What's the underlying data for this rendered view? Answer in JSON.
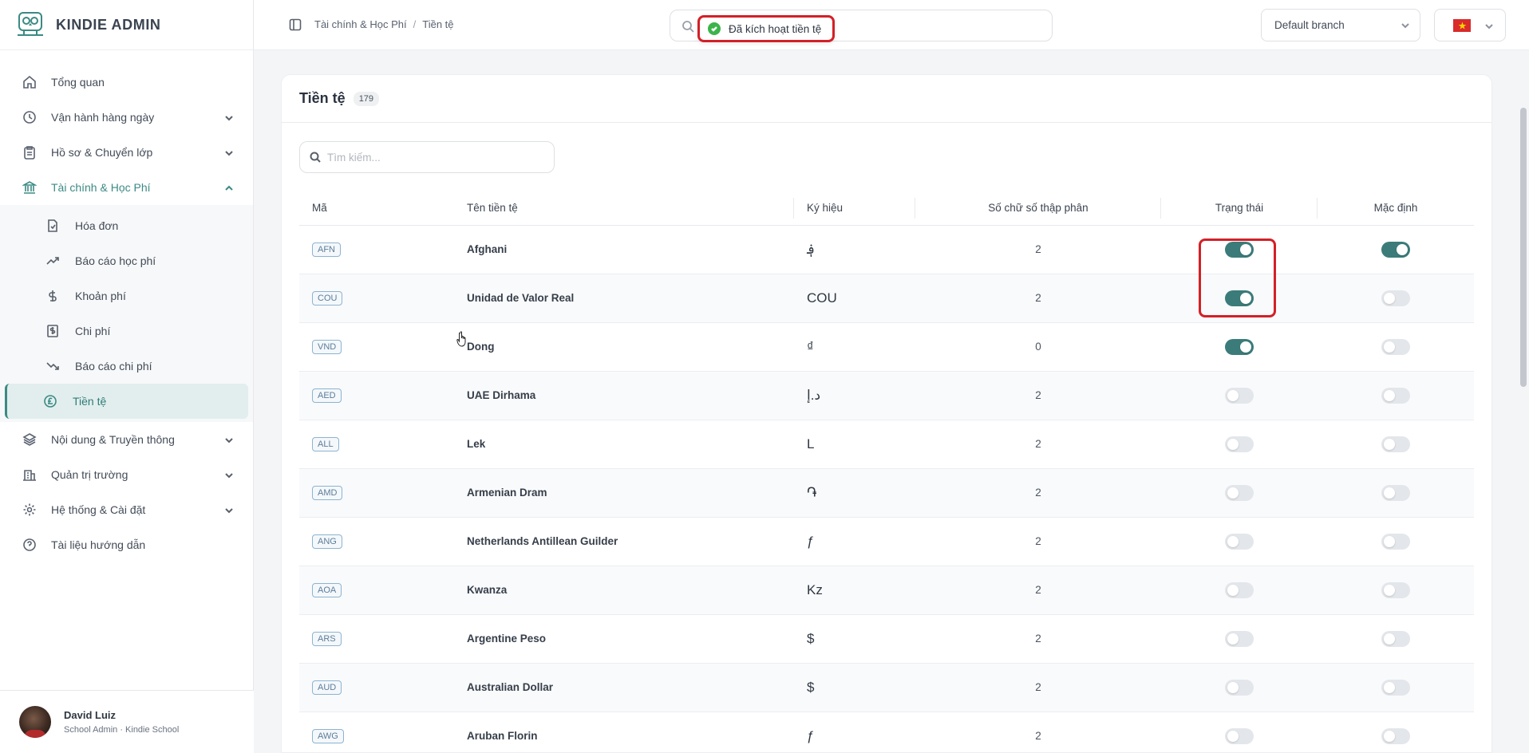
{
  "brand": {
    "name": "KINDIE ADMIN"
  },
  "sidebar": {
    "items": [
      {
        "label": "Tổng quan",
        "icon": "home-icon",
        "chevron": false
      },
      {
        "label": "Vận hành hàng ngày",
        "icon": "clock-icon",
        "chevron": true
      },
      {
        "label": "Hồ sơ & Chuyển lớp",
        "icon": "clipboard-icon",
        "chevron": true
      },
      {
        "label": "Tài chính & Học Phí",
        "icon": "bank-icon",
        "chevron": true,
        "expanded": true
      }
    ],
    "subitems": [
      {
        "label": "Hóa đơn",
        "icon": "invoice-icon"
      },
      {
        "label": "Báo cáo học phí",
        "icon": "trend-up-icon"
      },
      {
        "label": "Khoản phí",
        "icon": "dollar-icon"
      },
      {
        "label": "Chi phí",
        "icon": "receipt-icon"
      },
      {
        "label": "Báo cáo chi phí",
        "icon": "trend-down-icon"
      },
      {
        "label": "Tiền tệ",
        "icon": "pound-coin-icon",
        "active": true
      }
    ],
    "items_after": [
      {
        "label": "Nội dung & Truyền thông",
        "icon": "layers-icon",
        "chevron": true
      },
      {
        "label": "Quản trị trường",
        "icon": "building-icon",
        "chevron": true
      },
      {
        "label": "Hệ thống & Cài đặt",
        "icon": "gear-icon",
        "chevron": true
      },
      {
        "label": "Tài liệu hướng dẫn",
        "icon": "help-icon",
        "chevron": false
      }
    ]
  },
  "user": {
    "name": "David Luiz",
    "role": "School Admin · Kindie School"
  },
  "header": {
    "breadcrumb": [
      "Tài chính & Học Phí",
      "Tiền tệ"
    ],
    "toast": "Đã kích hoạt tiền tệ",
    "branch": "Default branch",
    "language_flag": "vietnam-flag"
  },
  "page": {
    "title": "Tiền tệ",
    "count": "179",
    "search_placeholder": "Tìm kiếm..."
  },
  "table": {
    "columns": [
      "Mã",
      "Tên tiền tệ",
      "Ký hiệu",
      "Số chữ số thập phân",
      "Trạng thái",
      "Mặc định"
    ],
    "rows": [
      {
        "code": "AFN",
        "name": "Afghani",
        "symbol": "؋",
        "decimals": "2",
        "status": true,
        "default": true
      },
      {
        "code": "COU",
        "name": "Unidad de Valor Real",
        "symbol": "COU",
        "decimals": "2",
        "status": true,
        "default": false
      },
      {
        "code": "VND",
        "name": "Dong",
        "symbol": "₫",
        "decimals": "0",
        "status": true,
        "default": false
      },
      {
        "code": "AED",
        "name": "UAE Dirhama",
        "symbol": "د.إ",
        "decimals": "2",
        "status": false,
        "default": false
      },
      {
        "code": "ALL",
        "name": "Lek",
        "symbol": "L",
        "decimals": "2",
        "status": false,
        "default": false
      },
      {
        "code": "AMD",
        "name": "Armenian Dram",
        "symbol": "֏",
        "decimals": "2",
        "status": false,
        "default": false
      },
      {
        "code": "ANG",
        "name": "Netherlands Antillean Guilder",
        "symbol": "ƒ",
        "decimals": "2",
        "status": false,
        "default": false
      },
      {
        "code": "AOA",
        "name": "Kwanza",
        "symbol": "Kz",
        "decimals": "2",
        "status": false,
        "default": false
      },
      {
        "code": "ARS",
        "name": "Argentine Peso",
        "symbol": "$",
        "decimals": "2",
        "status": false,
        "default": false
      },
      {
        "code": "AUD",
        "name": "Australian Dollar",
        "symbol": "$",
        "decimals": "2",
        "status": false,
        "default": false
      },
      {
        "code": "AWG",
        "name": "Aruban Florin",
        "symbol": "ƒ",
        "decimals": "2",
        "status": false,
        "default": false
      }
    ]
  },
  "colors": {
    "accent": "#3b7c7a",
    "highlight": "#d32027",
    "toast_ok": "#3bb44a"
  }
}
